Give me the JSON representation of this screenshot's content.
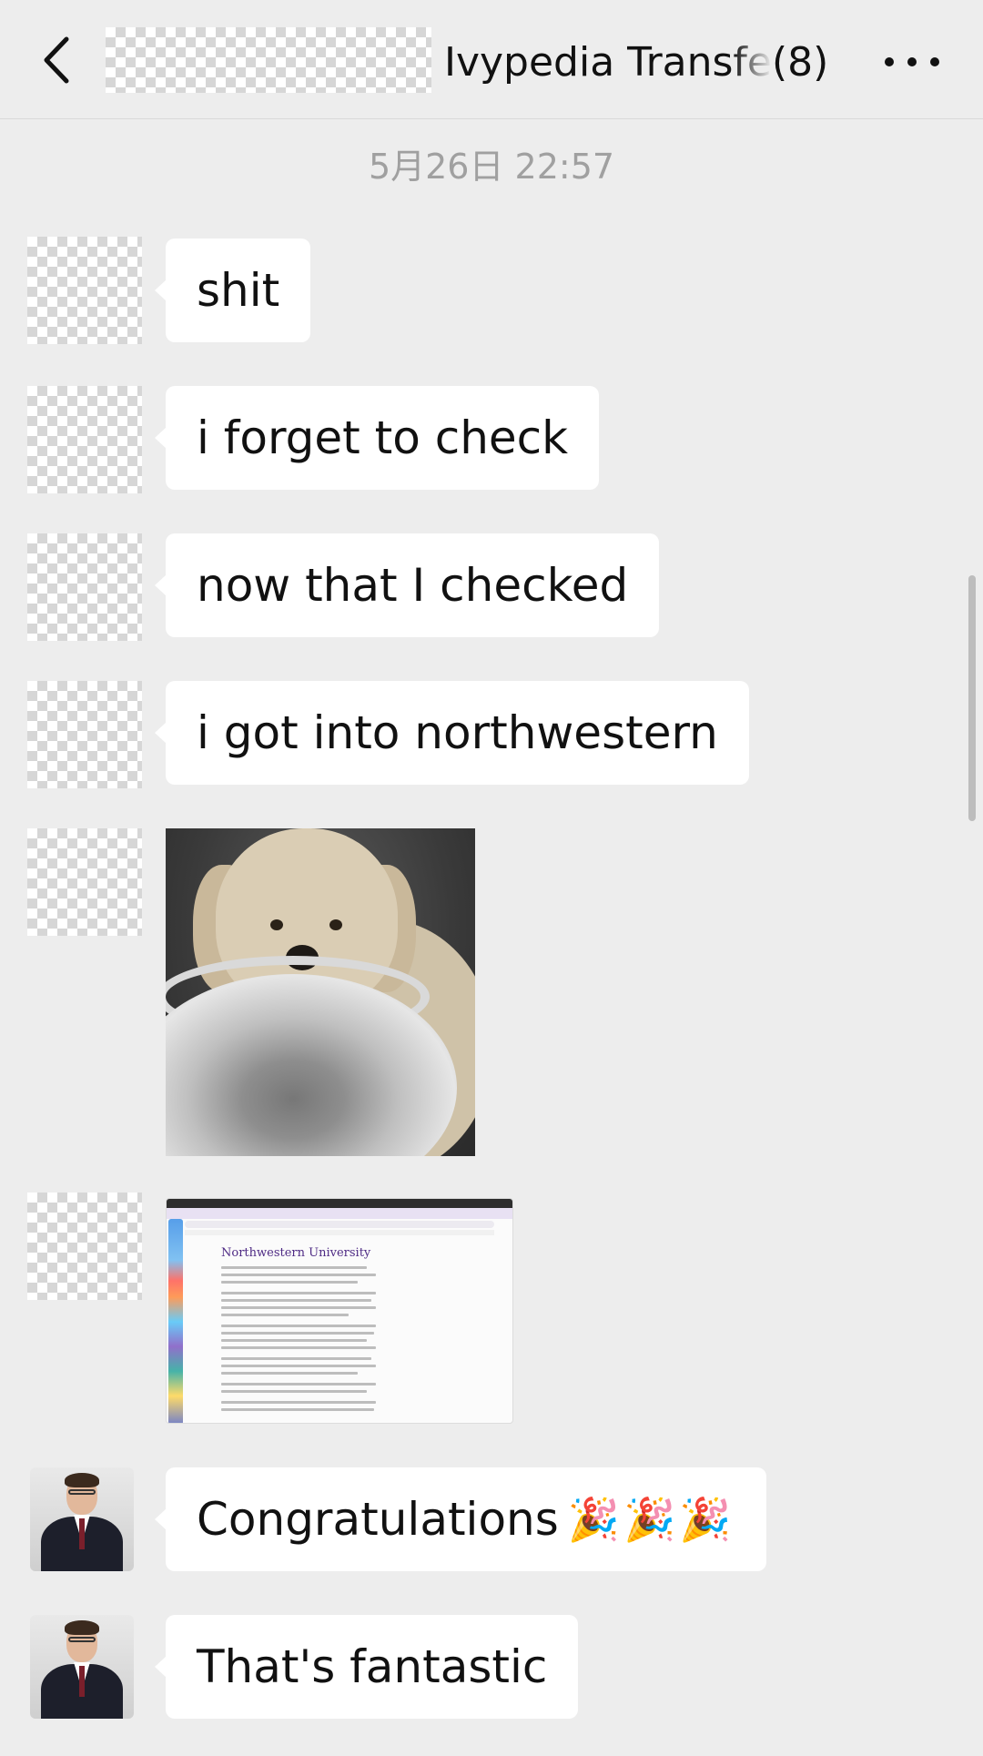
{
  "header": {
    "title": "Ivypedia Transfe",
    "member_count": "(8)",
    "back_icon": "chevron-left-icon",
    "more_icon": "more-dots-icon"
  },
  "timestamp": "5月26日 22:57",
  "messages": [
    {
      "sender": "redacted",
      "type": "text",
      "text": "shit"
    },
    {
      "sender": "redacted",
      "type": "text",
      "text": "i forget to check"
    },
    {
      "sender": "redacted",
      "type": "text",
      "text": "now that I checked"
    },
    {
      "sender": "redacted",
      "type": "text",
      "text": "i got into northwestern"
    },
    {
      "sender": "redacted",
      "type": "image",
      "image": "dog-with-bowl-sticker"
    },
    {
      "sender": "redacted",
      "type": "image",
      "image": "admission-letter-screenshot",
      "heading": "Northwestern University"
    },
    {
      "sender": "suited-man",
      "type": "text",
      "text": "Congratulations",
      "emoji": "🎉🎉🎉"
    },
    {
      "sender": "suited-man",
      "type": "text",
      "text": "That's fantastic"
    }
  ],
  "colors": {
    "background": "#ededed",
    "bubble": "#ffffff",
    "timestamp": "#a0a0a0",
    "text": "#111111"
  }
}
